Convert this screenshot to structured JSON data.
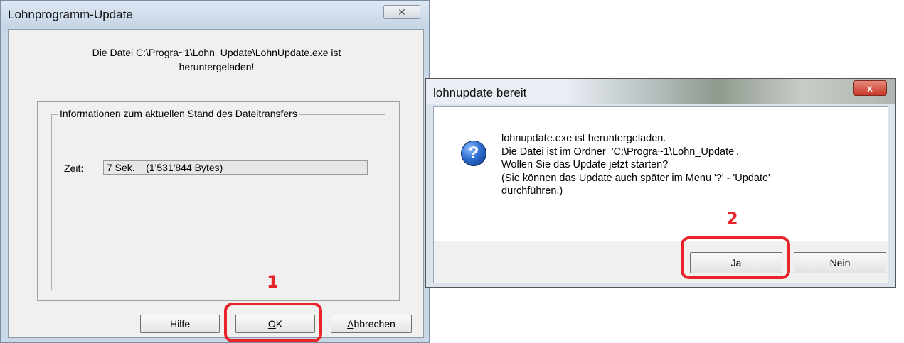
{
  "window1": {
    "title": "Lohnprogramm-Update",
    "close_label": "✕",
    "message_line1": "Die Datei C:\\Progra~1\\Lohn_Update\\LohnUpdate.exe ist",
    "message_line2": "heruntergeladen!",
    "group_label": "Informationen zum aktuellen Stand des Dateitransfers",
    "zeit_label": "Zeit:",
    "zeit_value": "7 Sek.    (1'531'844 Bytes)",
    "buttons": {
      "hilfe": "Hilfe",
      "ok_first": "O",
      "ok_rest": "K",
      "abbrechen_first": "A",
      "abbrechen_rest": "bbrechen"
    },
    "annotation": "1"
  },
  "window2": {
    "title": "lohnupdate bereit",
    "close_label": "x",
    "icon": "question-icon",
    "icon_glyph": "?",
    "message_lines": [
      "lohnupdate.exe ist heruntergeladen.",
      "Die Datei ist im Ordner  'C:\\Progra~1\\Lohn_Update'.",
      "Wollen Sie das Update jetzt starten?",
      "(Sie können das Update auch später im Menu '?' - 'Update'",
      "durchführen.)"
    ],
    "buttons": {
      "ja": "Ja",
      "nein": "Nein"
    },
    "annotation": "2"
  },
  "colors": {
    "highlight": "#e8232a"
  }
}
